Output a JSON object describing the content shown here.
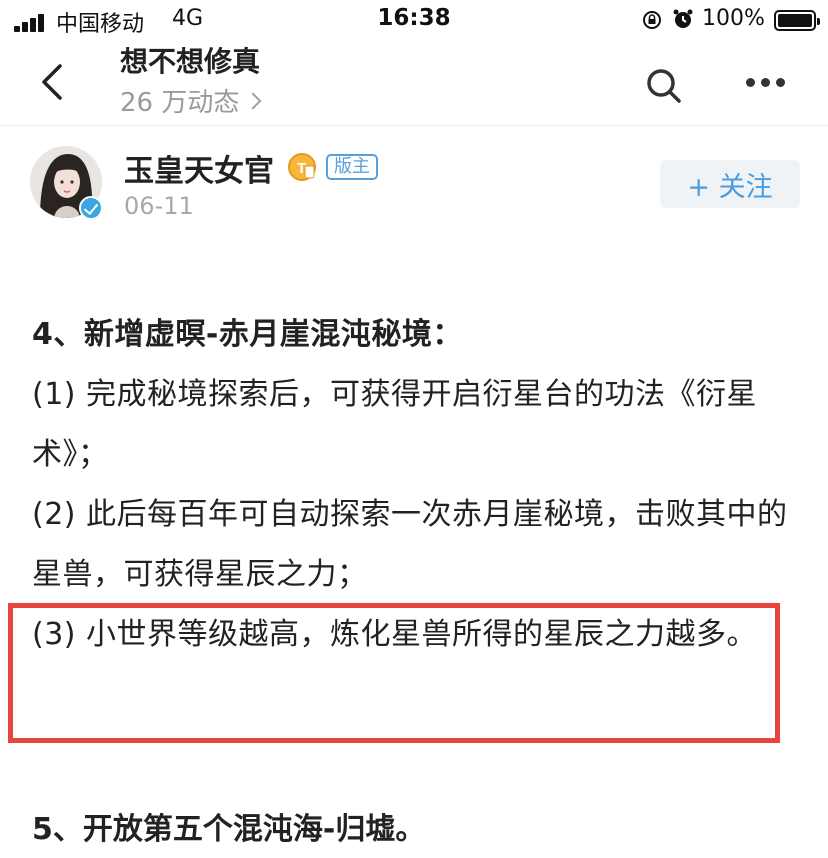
{
  "status_bar": {
    "carrier": "中国移动",
    "network": "4G",
    "time": "16:38",
    "battery": "100%"
  },
  "header": {
    "forum_name": "想不想修真",
    "activity_count": "26 万动态"
  },
  "author": {
    "name": "玉皇天女官",
    "level_badge": "T",
    "role": "版主",
    "date": "06-11",
    "follow_label": "+ 关注"
  },
  "post": {
    "heading_4": "4、新增虚暝-赤月崖混沌秘境：",
    "item_1": "(1) 完成秘境探索后，可获得开启衍星台的功法《衍星术》；",
    "item_2": "(2) 此后每百年可自动探索一次赤月崖秘境，击败其中的星兽，可获得星辰之力；",
    "item_3": "(3) 小世界等级越高，炼化星兽所得的星辰之力越多。",
    "heading_5": "5、开放第五个混沌海-归墟。"
  },
  "colors": {
    "accent_blue": "#4a9ee0",
    "highlight_red": "#e8453c",
    "muted_gray": "#9a9a9a"
  }
}
